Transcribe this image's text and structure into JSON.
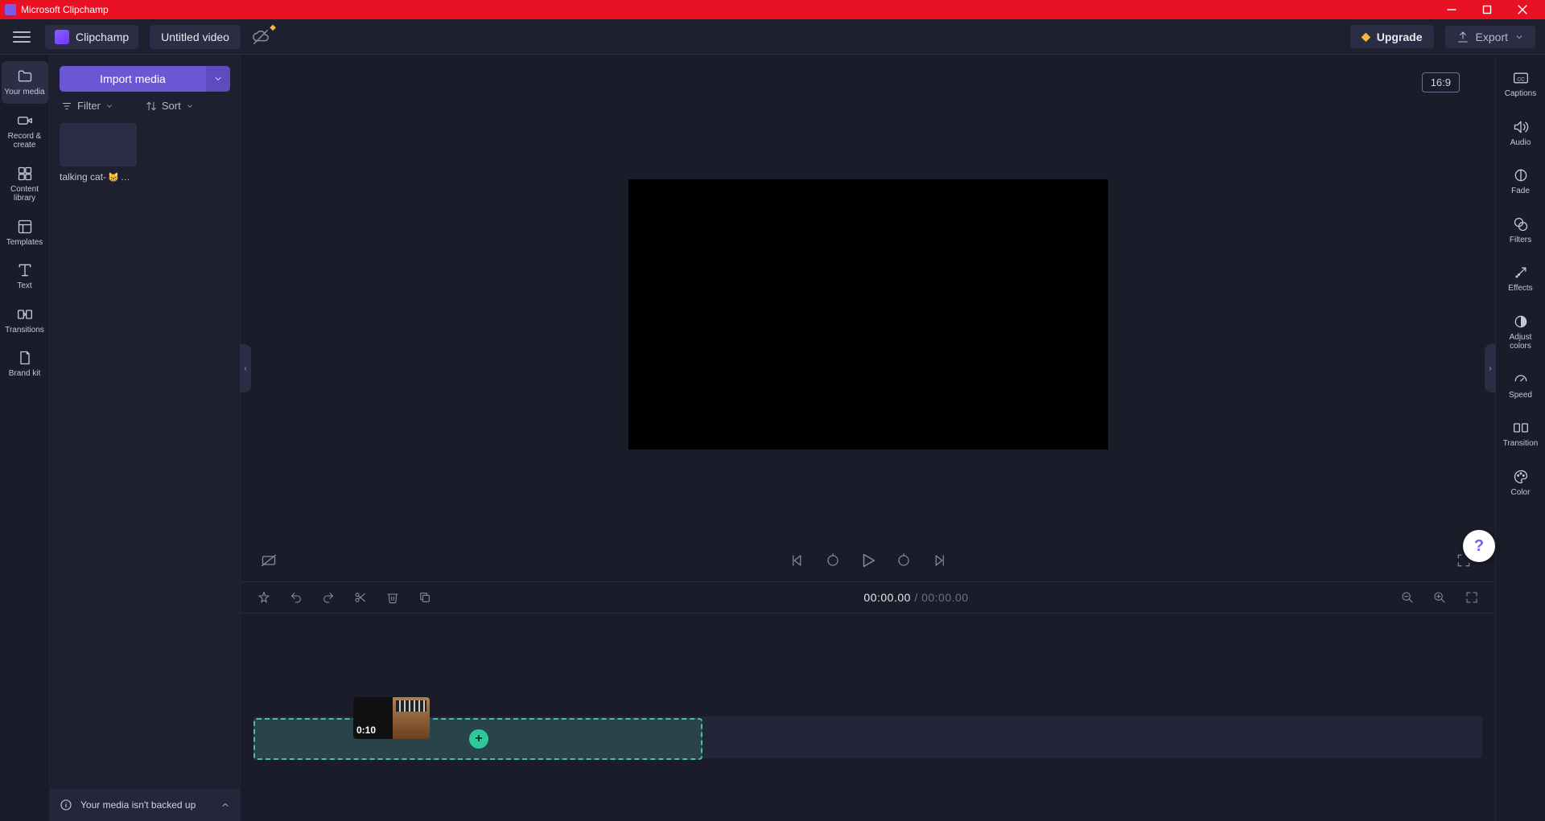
{
  "window": {
    "title": "Microsoft Clipchamp"
  },
  "header": {
    "brand": "Clipchamp",
    "project_name": "Untitled video",
    "upgrade_label": "Upgrade",
    "export_label": "Export"
  },
  "leftnav": {
    "your_media": "Your media",
    "record_create": "Record & create",
    "content_library": "Content library",
    "templates": "Templates",
    "text": "Text",
    "transitions": "Transitions",
    "brand_kit": "Brand kit"
  },
  "media_panel": {
    "import_label": "Import media",
    "filter_label": "Filter",
    "sort_label": "Sort",
    "items": [
      {
        "name": "talking cat-",
        "emoji": "😸",
        "suffix": "…"
      }
    ],
    "backup_msg": "Your media isn't backed up"
  },
  "preview": {
    "aspect_ratio": "16:9",
    "time_current": "00:00.00",
    "time_total": "00:00.00"
  },
  "timeline": {
    "drag_clip_duration": "0:10",
    "add_icon": "+"
  },
  "rightnav": {
    "captions": "Captions",
    "audio": "Audio",
    "fade": "Fade",
    "filters": "Filters",
    "effects": "Effects",
    "adjust_colors": "Adjust colors",
    "speed": "Speed",
    "transition": "Transition",
    "color": "Color"
  },
  "help": {
    "label": "?"
  }
}
